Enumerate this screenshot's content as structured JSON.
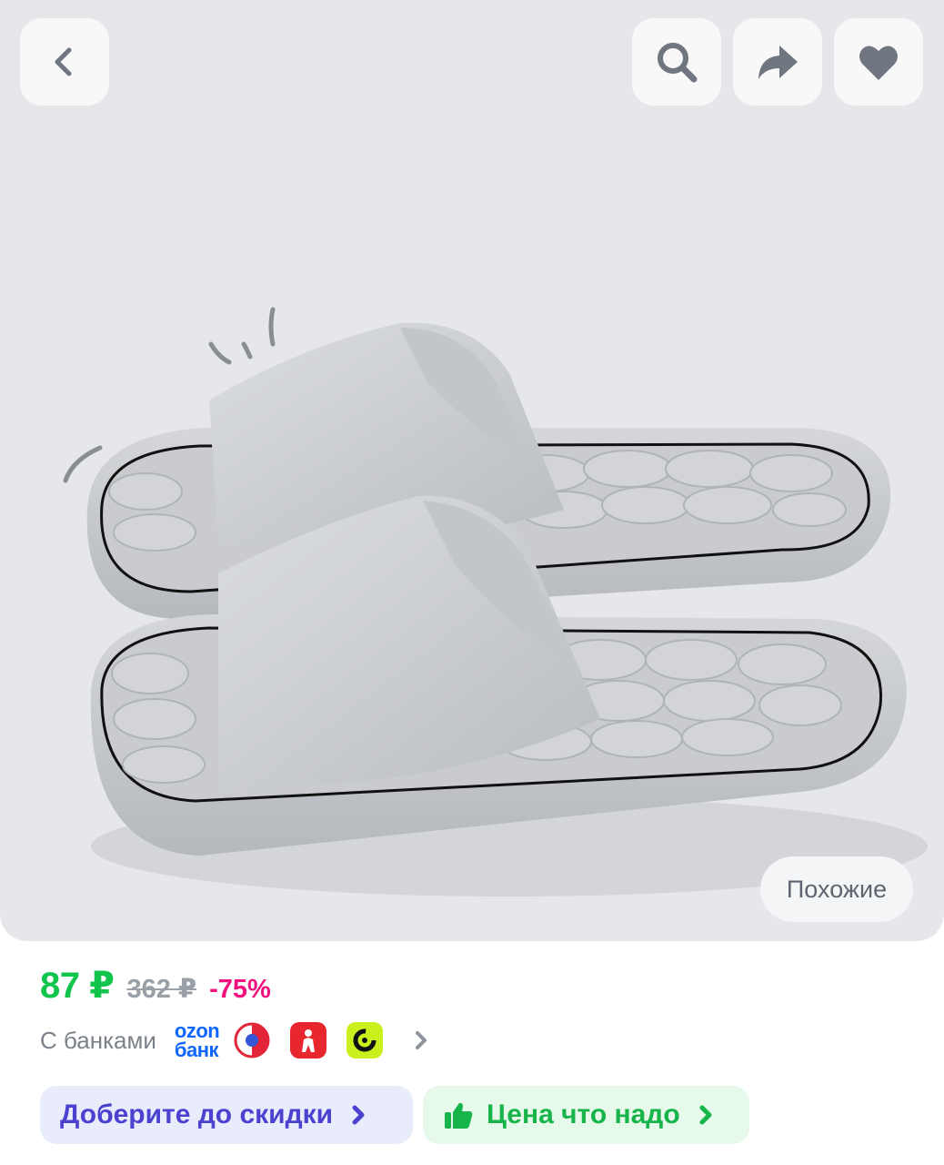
{
  "product": {
    "image_alt": "Серые шлёпанцы на толстой подошве",
    "similar_label": "Похожие"
  },
  "header": {
    "icons": [
      "back-icon",
      "search-icon",
      "share-icon",
      "heart-icon"
    ]
  },
  "price": {
    "current": "87 ₽",
    "old": "362 ₽",
    "discount": "-75%"
  },
  "banks": {
    "label": "С банками",
    "ozon_line1": "ozon",
    "ozon_line2": "банк"
  },
  "actions": {
    "discount_label": "Доберите до скидки",
    "price_label": "Цена что надо"
  },
  "colors": {
    "price": "#10c44c",
    "discount": "#f1117e",
    "discount_pill": "#4b43cf",
    "price_pill": "#17b44a"
  }
}
